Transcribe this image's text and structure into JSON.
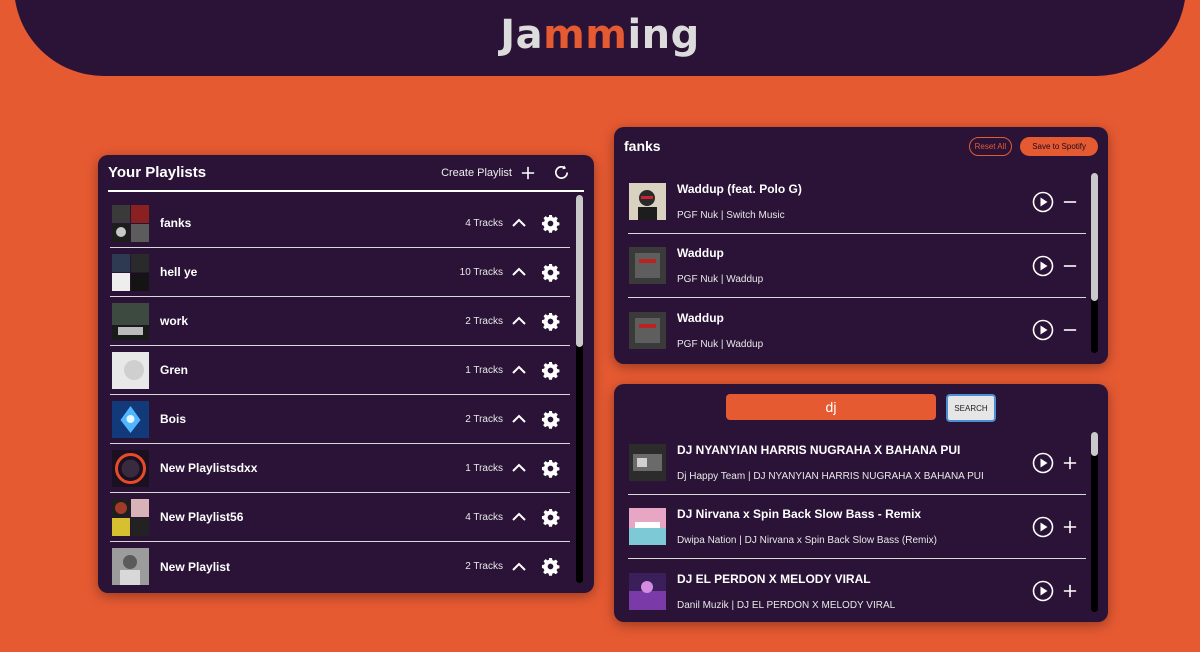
{
  "app": {
    "logo_part1": "Ja",
    "logo_part2": "mm",
    "logo_part3": "ing",
    "colors": {
      "accent": "#e65a32",
      "panel": "#2a1336",
      "text": "#ffffff"
    }
  },
  "playlists": {
    "title": "Your Playlists",
    "create_label": "Create Playlist",
    "items": [
      {
        "name": "fanks",
        "tracks": "4 Tracks"
      },
      {
        "name": "hell ye",
        "tracks": "10 Tracks"
      },
      {
        "name": "work",
        "tracks": "2 Tracks"
      },
      {
        "name": "Gren",
        "tracks": "1 Tracks"
      },
      {
        "name": "Bois",
        "tracks": "2 Tracks"
      },
      {
        "name": "New Playlistsdxx",
        "tracks": "1 Tracks"
      },
      {
        "name": "New Playlist56",
        "tracks": "4 Tracks"
      },
      {
        "name": "New Playlist",
        "tracks": "2 Tracks"
      }
    ]
  },
  "current": {
    "title": "fanks",
    "reset_label": "Reset All",
    "save_label": "Save to Spotify",
    "tracks": [
      {
        "name": "Waddup (feat. Polo G)",
        "sub": "PGF Nuk | Switch Music"
      },
      {
        "name": "Waddup",
        "sub": "PGF Nuk | Waddup"
      },
      {
        "name": "Waddup",
        "sub": "PGF Nuk | Waddup"
      }
    ]
  },
  "search": {
    "query": "dj",
    "button_label": "SEARCH",
    "results": [
      {
        "name": "DJ NYANYIAN HARRIS NUGRAHA X BAHANA PUI",
        "sub": "Dj Happy Team | DJ NYANYIAN HARRIS NUGRAHA X BAHANA PUI"
      },
      {
        "name": "DJ Nirvana x Spin Back Slow Bass - Remix",
        "sub": "Dwipa Nation | DJ Nirvana x Spin Back Slow Bass (Remix)"
      },
      {
        "name": "DJ EL PERDON X MELODY VIRAL",
        "sub": "Danil Muzik | DJ EL PERDON X MELODY VIRAL"
      }
    ]
  }
}
